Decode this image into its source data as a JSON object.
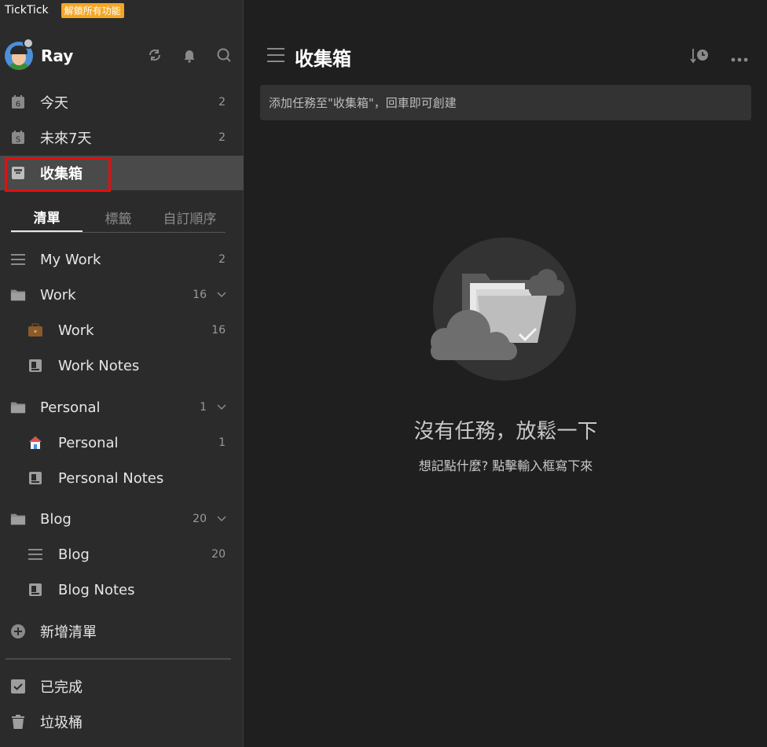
{
  "app": {
    "name": "TickTick",
    "upgrade_badge": "解鎖所有功能"
  },
  "user": {
    "name": "Ray"
  },
  "smart_lists": [
    {
      "label": "今天",
      "count": "2",
      "icon": "calendar-6-icon"
    },
    {
      "label": "未來7天",
      "count": "2",
      "icon": "calendar-s-icon"
    },
    {
      "label": "收集箱",
      "count": "",
      "icon": "inbox-icon",
      "active": true
    }
  ],
  "tabs": [
    {
      "label": "清單",
      "active": true
    },
    {
      "label": "標籤"
    },
    {
      "label": "自訂順序"
    }
  ],
  "lists": {
    "my_work": {
      "label": "My Work",
      "count": "2"
    },
    "work_folder": {
      "label": "Work",
      "count": "16"
    },
    "work": {
      "label": "Work",
      "count": "16"
    },
    "work_notes": {
      "label": "Work Notes"
    },
    "personal_folder": {
      "label": "Personal",
      "count": "1"
    },
    "personal": {
      "label": "Personal",
      "count": "1"
    },
    "personal_notes": {
      "label": "Personal Notes"
    },
    "blog_folder": {
      "label": "Blog",
      "count": "20"
    },
    "blog": {
      "label": "Blog",
      "count": "20"
    },
    "blog_notes": {
      "label": "Blog Notes"
    }
  },
  "add_list": {
    "label": "新增清單"
  },
  "completed": {
    "label": "已完成"
  },
  "trash": {
    "label": "垃圾桶"
  },
  "main": {
    "title": "收集箱",
    "add_task_placeholder": "添加任務至\"收集箱\"，回車即可創建",
    "empty_title": "沒有任務，放鬆一下",
    "empty_subtitle": "想記點什麼? 點擊輸入框寫下來"
  },
  "colors": {
    "sidebar_bg": "#2b2b2b",
    "main_bg": "#1f1f1f",
    "active_item_bg": "#4a4a4a",
    "badge": "#f5a623",
    "highlight": "#e01010"
  }
}
